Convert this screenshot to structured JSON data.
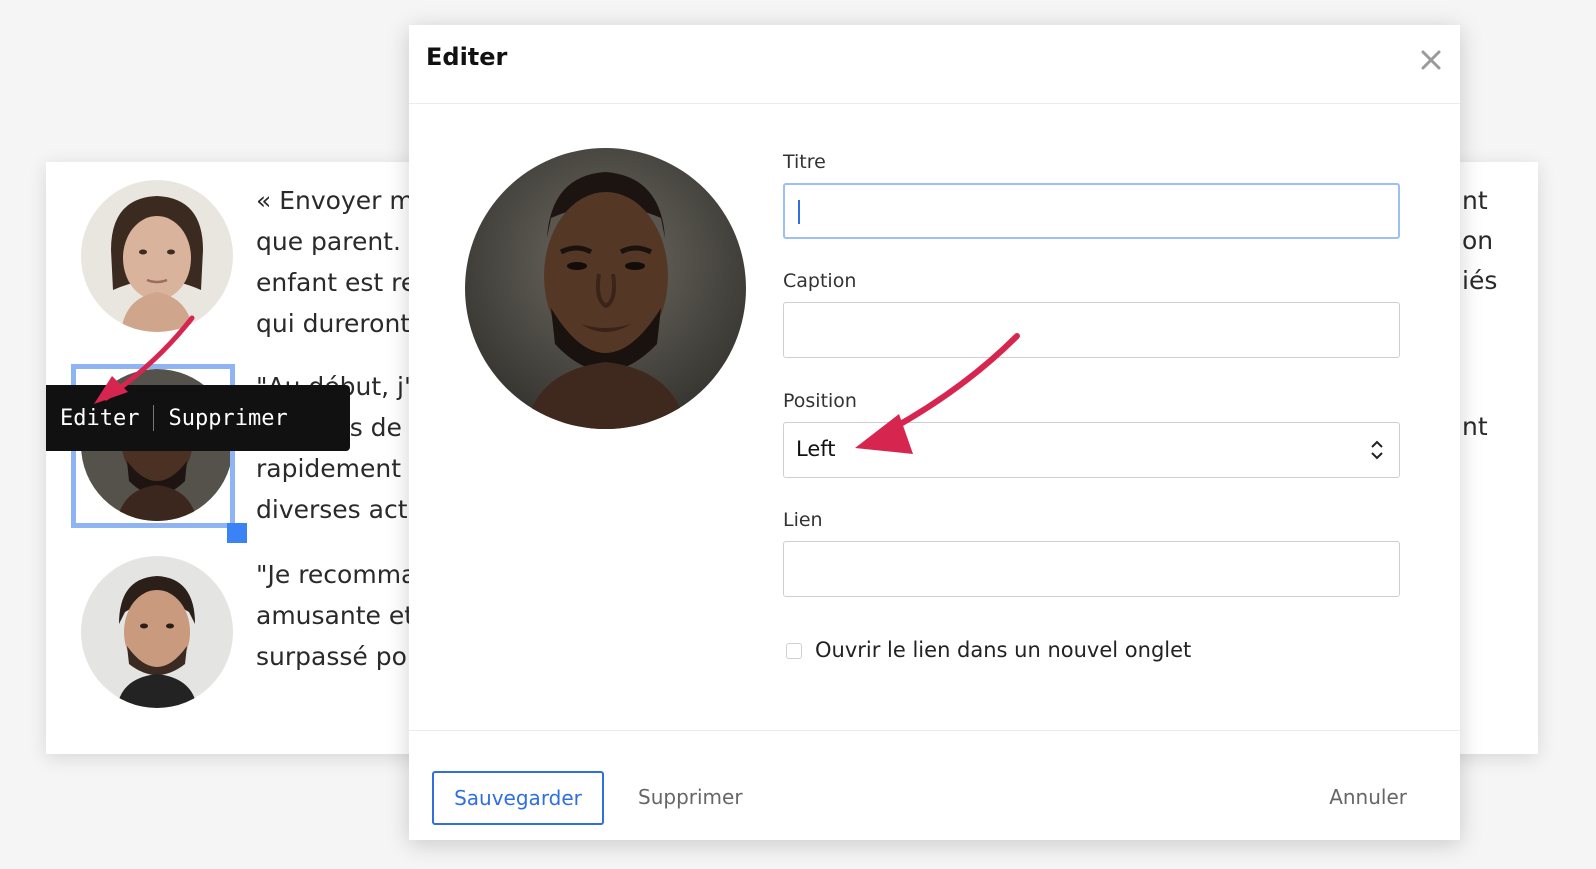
{
  "background": {
    "testimonials": [
      {
        "lines": [
          "« Envoyer mo",
          "que parent.",
          "enfant est re",
          "qui dureront"
        ],
        "avatar": "woman-portrait"
      },
      {
        "lines": [
          "\"Au début, j'",
          "mesures de s",
          "rapidement r",
          "diverses acti"
        ],
        "avatar": "man-portrait-dark"
      },
      {
        "lines": [
          "\"Je recomma",
          "amusante et",
          "surpassé pou"
        ],
        "avatar": "man-portrait-beard"
      }
    ],
    "right_fragments": [
      "nt",
      "on",
      "iés",
      "nt"
    ]
  },
  "toolbar": {
    "edit_label": "Editer",
    "delete_label": "Supprimer"
  },
  "modal": {
    "title": "Editer",
    "close_icon": "close-icon",
    "fields": {
      "titre": {
        "label": "Titre",
        "value": ""
      },
      "caption": {
        "label": "Caption",
        "value": ""
      },
      "position": {
        "label": "Position",
        "value": "Left"
      },
      "lien": {
        "label": "Lien",
        "value": ""
      }
    },
    "checkbox_label": "Ouvrir le lien dans un nouvel onglet",
    "checkbox_checked": false,
    "footer": {
      "save": "Sauvegarder",
      "delete": "Supprimer",
      "cancel": "Annuler"
    }
  },
  "colors": {
    "accent": "#2f6fe0",
    "selection": "#8fb4f4",
    "annotation_arrow": "#d6264f"
  }
}
